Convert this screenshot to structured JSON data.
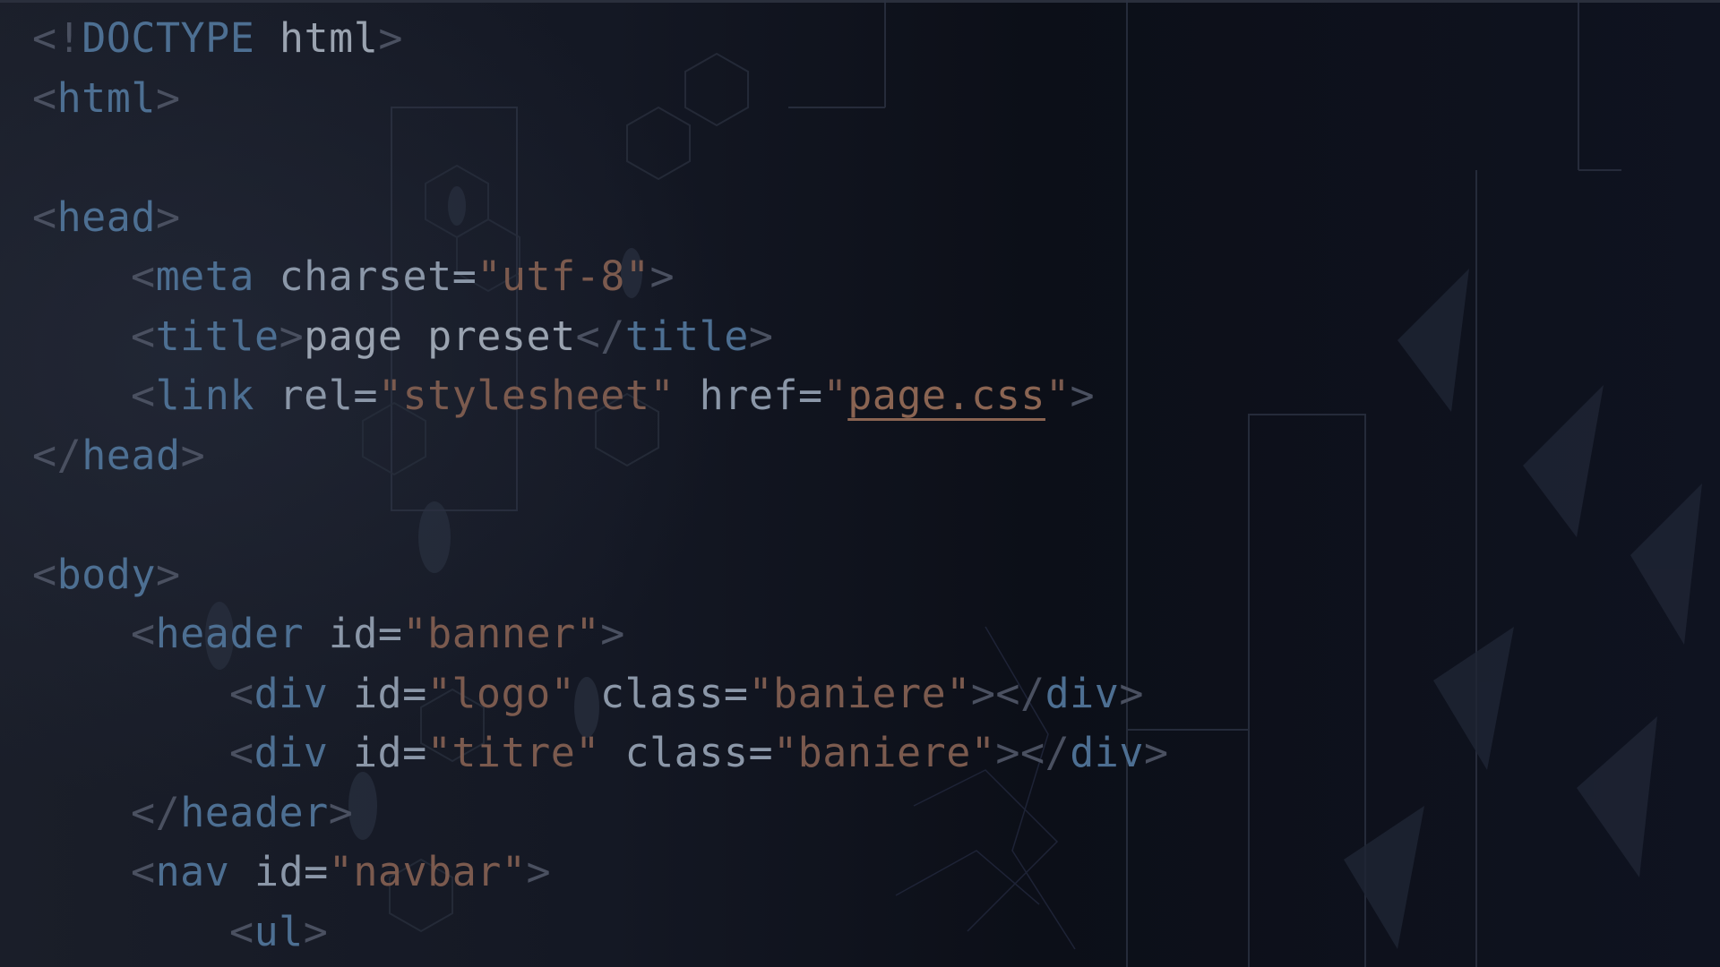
{
  "code_lines": [
    {
      "doctype_open": "<!",
      "doctype_kw": "DOCTYPE",
      "doctype_html": " html",
      "doctype_close": ">"
    },
    {
      "open": "<",
      "tag": "html",
      "close": ">"
    },
    {},
    {
      "open": "<",
      "tag": "head",
      "close": ">"
    },
    {
      "open": "<",
      "tag": "meta",
      "attr": " charset=",
      "value": "\"utf-8\"",
      "close": ">"
    },
    {
      "open": "<",
      "tag": "title",
      "close1": ">",
      "text": "page preset",
      "open2": "</",
      "tag2": "title",
      "close2": ">"
    },
    {
      "open": "<",
      "tag": "link",
      "attr1": " rel=",
      "value1": "\"stylesheet\"",
      "attr2": " href=",
      "quote1": "\"",
      "link": "page.css",
      "quote2": "\"",
      "close": ">"
    },
    {
      "open": "</",
      "tag": "head",
      "close": ">"
    },
    {},
    {
      "open": "<",
      "tag": "body",
      "close": ">"
    },
    {
      "open": "<",
      "tag": "header",
      "attr": " id=",
      "value": "\"banner\"",
      "close": ">"
    },
    {
      "open": "<",
      "tag": "div",
      "attr1": " id=",
      "value1": "\"logo\"",
      "attr2": " class=",
      "value2": "\"baniere\"",
      "close1": ">",
      "open2": "</",
      "tag2": "div",
      "close2": ">"
    },
    {
      "open": "<",
      "tag": "div",
      "attr1": " id=",
      "value1": "\"titre\"",
      "attr2": " class=",
      "value2": "\"baniere\"",
      "close1": ">",
      "open2": "</",
      "tag2": "div",
      "close2": ">"
    },
    {
      "open": "</",
      "tag": "header",
      "close": ">"
    },
    {
      "open": "<",
      "tag": "nav",
      "attr": " id=",
      "value": "\"navbar\"",
      "close": ">"
    },
    {
      "open": "<",
      "tag": "ul",
      "close": ">"
    }
  ],
  "colors": {
    "background": "#141824",
    "tag": "#4d6f92",
    "attribute": "#8b97a8",
    "value": "#7b5a4e",
    "punctuation": "#4a5060"
  }
}
